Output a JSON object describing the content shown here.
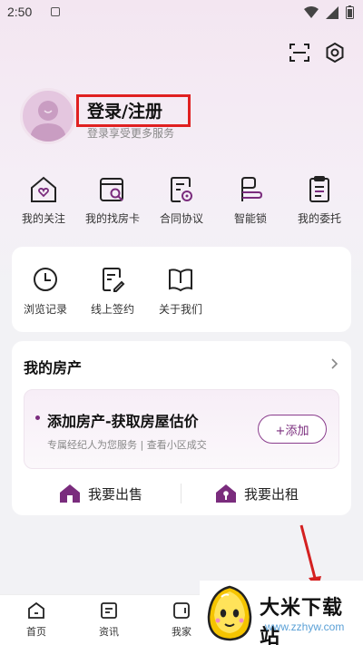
{
  "status_bar": {
    "time": "2:50"
  },
  "header": {
    "scan_icon": "scan-icon",
    "settings_icon": "settings-icon"
  },
  "profile": {
    "login_title": "登录/注册",
    "subtitle": "登录享受更多服务"
  },
  "quick_actions": [
    {
      "label": "我的关注",
      "icon": "house-heart-icon"
    },
    {
      "label": "我的找房卡",
      "icon": "search-card-icon"
    },
    {
      "label": "合同协议",
      "icon": "contract-icon"
    },
    {
      "label": "智能锁",
      "icon": "smart-lock-icon"
    },
    {
      "label": "我的委托",
      "icon": "entrust-icon"
    }
  ],
  "tools": [
    {
      "label": "浏览记录",
      "icon": "clock-icon"
    },
    {
      "label": "线上签约",
      "icon": "sign-icon"
    },
    {
      "label": "关于我们",
      "icon": "book-icon"
    }
  ],
  "property": {
    "title": "我的房产",
    "add_title": "添加房产-获取房屋估价",
    "add_sub": "专属经纪人为您服务 | 查看小区成交",
    "add_button": "+添加",
    "sell_label": "我要出售",
    "rent_label": "我要出租"
  },
  "tabbar": [
    {
      "label": "首页",
      "icon": "home-icon"
    },
    {
      "label": "资讯",
      "icon": "news-icon"
    },
    {
      "label": "我家",
      "icon": "my-home-icon"
    }
  ],
  "watermark": {
    "title": "大米下载站",
    "url": "www.zzhyw.com"
  },
  "colors": {
    "accent": "#7a2c7d",
    "highlight_box": "#e02020",
    "annotation_arrow": "#d42020"
  }
}
